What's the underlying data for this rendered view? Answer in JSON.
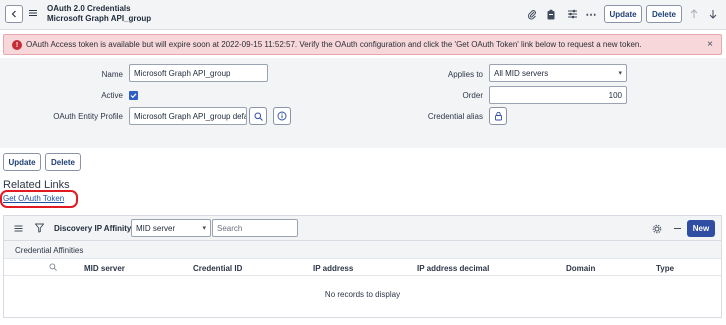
{
  "header": {
    "title_line1": "OAuth 2.0 Credentials",
    "title_line2": "Microsoft Graph API_group",
    "update_label": "Update",
    "delete_label": "Delete"
  },
  "alert": {
    "message": "OAuth Access token is available but will expire soon at 2022-09-15 11:52:57. Verify the OAuth configuration and click the 'Get OAuth Token' link below to request a new token.",
    "close": "×",
    "icon": "!"
  },
  "form": {
    "name_label": "Name",
    "name_value": "Microsoft Graph API_group",
    "active_label": "Active",
    "active_checked": true,
    "profile_label": "OAuth Entity Profile",
    "profile_value": "Microsoft Graph API_group defa",
    "applies_label": "Applies to",
    "applies_value": "All MID servers",
    "order_label": "Order",
    "order_value": "100",
    "alias_label": "Credential alias"
  },
  "bottom_actions": {
    "update_label": "Update",
    "delete_label": "Delete"
  },
  "related": {
    "title": "Related Links",
    "link": "Get OAuth Token"
  },
  "list": {
    "title": "Discovery IP Affinity",
    "select_value": "MID server",
    "search_placeholder": "Search",
    "new_label": "New",
    "subtitle": "Credential Affinities",
    "columns": [
      "MID server",
      "Credential ID",
      "IP address",
      "IP address decimal",
      "Domain",
      "Type"
    ],
    "empty_message": "No records to display"
  },
  "colors": {
    "accent": "#2f4ea3",
    "alert_bg": "#f7d7da",
    "alert_icon": "#c22d36",
    "highlight": "#e01b24"
  },
  "icons": [
    "chevron-left-icon",
    "hamburger-menu-icon",
    "paperclip-icon",
    "clipboard-icon",
    "sliders-icon",
    "more-icon",
    "arrow-up-icon",
    "arrow-down-icon",
    "search-icon",
    "info-icon",
    "lock-icon",
    "filter-icon",
    "gear-icon",
    "minus-icon"
  ]
}
